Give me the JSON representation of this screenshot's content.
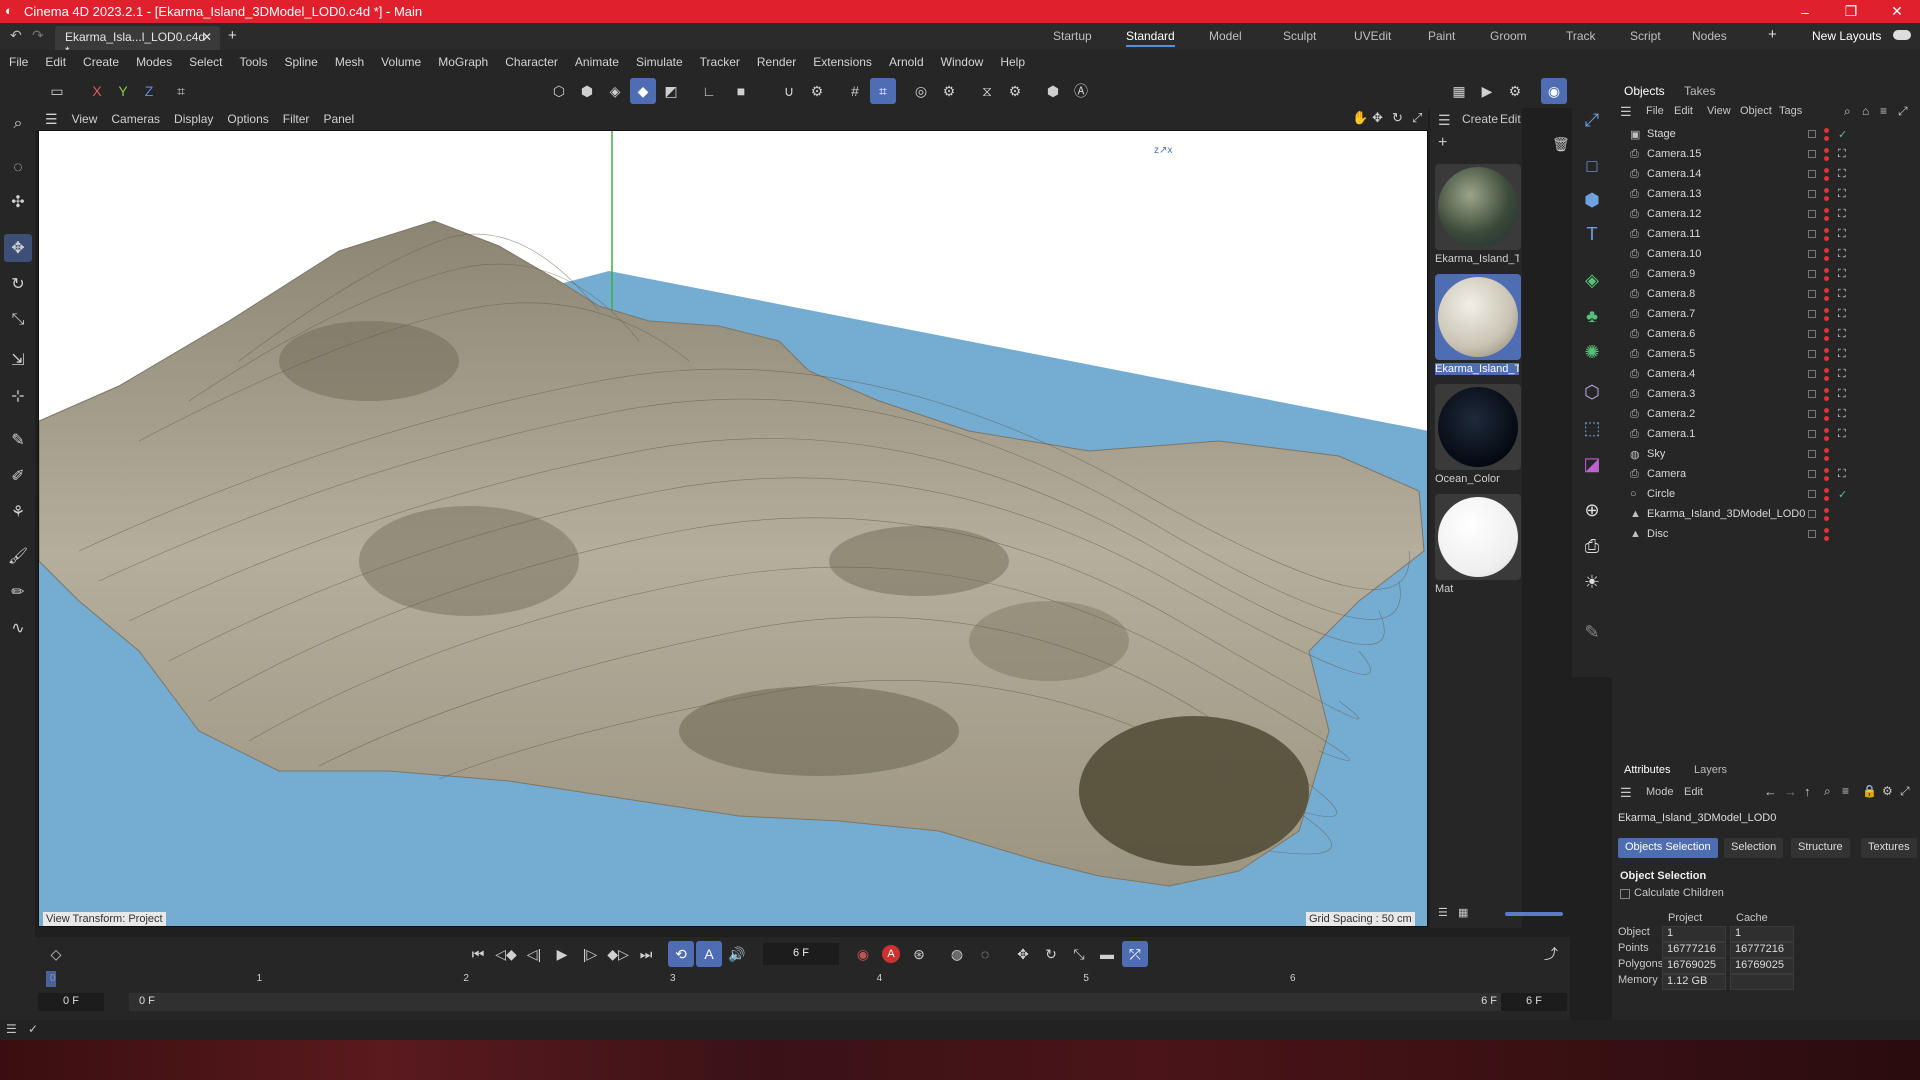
{
  "window": {
    "title": "Cinema 4D 2023.2.1 - [Ekarma_Island_3DModel_LOD0.c4d *] - Main"
  },
  "tabs": {
    "doc_tab": "Ekarma_Isla...l_LOD0.c4d *",
    "add": "+"
  },
  "layouts": [
    "Startup",
    "Standard",
    "Model",
    "Sculpt",
    "UVEdit",
    "Paint",
    "Groom",
    "Track",
    "Script",
    "Nodes"
  ],
  "layout_active": "Standard",
  "new_layouts": "New Layouts",
  "menu": [
    "File",
    "Edit",
    "Create",
    "Modes",
    "Select",
    "Tools",
    "Spline",
    "Mesh",
    "Volume",
    "MoGraph",
    "Character",
    "Animate",
    "Simulate",
    "Tracker",
    "Render",
    "Extensions",
    "Arnold",
    "Window",
    "Help"
  ],
  "axis": {
    "x": "X",
    "y": "Y",
    "z": "Z"
  },
  "viewport": {
    "menu": [
      "View",
      "Cameras",
      "Display",
      "Options",
      "Filter",
      "Panel"
    ],
    "footer_left": "View Transform: Project",
    "footer_right": "Grid Spacing : 50 cm",
    "bg_color": "#ffffff",
    "water_color": "#74acd2",
    "terrain_color": "#a29a86"
  },
  "materials": {
    "menu": [
      "Create",
      "Edit"
    ],
    "items": [
      {
        "label": "Ekarma_Island_Te",
        "kind": "globe"
      },
      {
        "label": "Ekarma_Island_Te",
        "kind": "white-rock",
        "selected": true
      },
      {
        "label": "Ocean_Color",
        "kind": "dark"
      },
      {
        "label": "Mat",
        "kind": "white"
      }
    ]
  },
  "objects": {
    "tabs": [
      "Objects",
      "Takes"
    ],
    "menu": [
      "File",
      "Edit",
      "View",
      "Object",
      "Tags"
    ],
    "rows": [
      {
        "name": "Stage",
        "icon": "stage-icon",
        "check": true
      },
      {
        "name": "Camera.15",
        "icon": "camera-icon"
      },
      {
        "name": "Camera.14",
        "icon": "camera-icon"
      },
      {
        "name": "Camera.13",
        "icon": "camera-icon"
      },
      {
        "name": "Camera.12",
        "icon": "camera-icon"
      },
      {
        "name": "Camera.11",
        "icon": "camera-icon"
      },
      {
        "name": "Camera.10",
        "icon": "camera-icon"
      },
      {
        "name": "Camera.9",
        "icon": "camera-icon"
      },
      {
        "name": "Camera.8",
        "icon": "camera-icon"
      },
      {
        "name": "Camera.7",
        "icon": "camera-icon"
      },
      {
        "name": "Camera.6",
        "icon": "camera-icon"
      },
      {
        "name": "Camera.5",
        "icon": "camera-icon"
      },
      {
        "name": "Camera.4",
        "icon": "camera-icon"
      },
      {
        "name": "Camera.3",
        "icon": "camera-icon"
      },
      {
        "name": "Camera.2",
        "icon": "camera-icon"
      },
      {
        "name": "Camera.1",
        "icon": "camera-icon"
      },
      {
        "name": "Sky",
        "icon": "sky-icon"
      },
      {
        "name": "Camera",
        "icon": "camera-icon"
      },
      {
        "name": "Circle",
        "icon": "circle-icon",
        "check": true
      },
      {
        "name": "Ekarma_Island_3DModel_LOD0",
        "icon": "mesh-icon"
      },
      {
        "name": "Disc",
        "icon": "mesh-icon"
      }
    ]
  },
  "attributes": {
    "tabs": [
      "Attributes",
      "Layers"
    ],
    "menu": [
      "Mode",
      "Edit"
    ],
    "object_name": "Ekarma_Island_3DModel_LOD0",
    "buttons": [
      "Objects Selection",
      "Selection",
      "Structure",
      "Textures"
    ],
    "section": "Object Selection",
    "calc_children": "Calculate Children",
    "col_headers": [
      "Project",
      "Cache"
    ],
    "rows": [
      {
        "label": "Object",
        "project": "1",
        "cache": "1"
      },
      {
        "label": "Points",
        "project": "16777216",
        "cache": "16777216"
      },
      {
        "label": "Polygons",
        "project": "16769025",
        "cache": "16769025"
      },
      {
        "label": "Memory",
        "project": "1.12 GB",
        "cache": ""
      }
    ]
  },
  "timeline": {
    "current_frame": "6 F",
    "ruler": [
      "0",
      "1",
      "2",
      "3",
      "4",
      "5",
      "6"
    ],
    "start": "0 F",
    "start2": "0 F",
    "end": "6 F",
    "end2": "6 F"
  }
}
